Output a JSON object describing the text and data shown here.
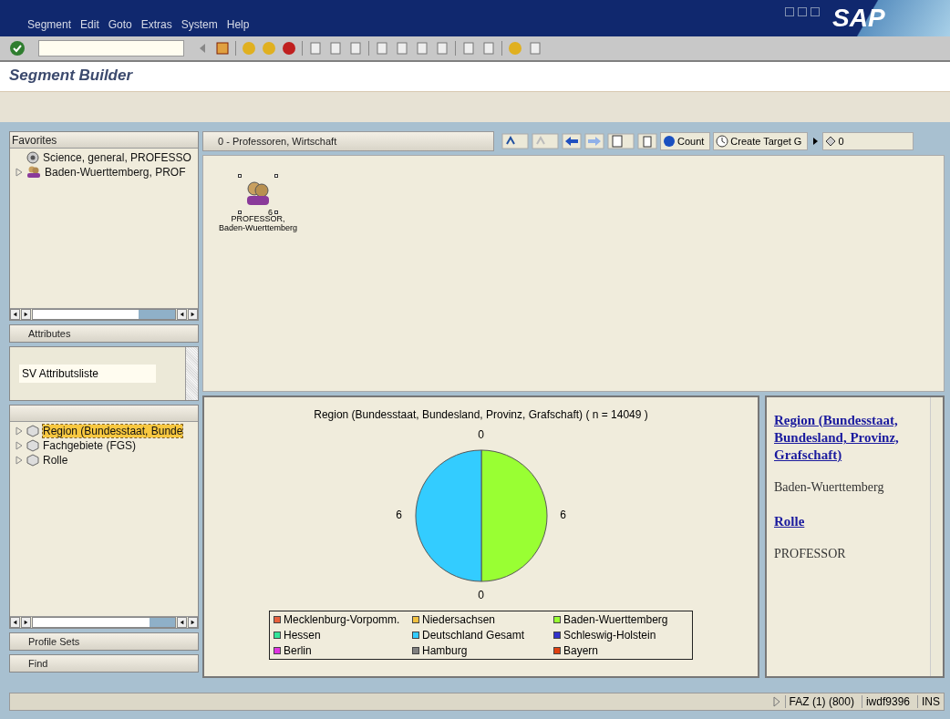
{
  "menu": [
    {
      "label": "Segment"
    },
    {
      "label": "Edit"
    },
    {
      "label": "Goto"
    },
    {
      "label": "Extras"
    },
    {
      "label": "System"
    },
    {
      "label": "Help"
    }
  ],
  "logo": "SAP",
  "page_title": "Segment Builder",
  "favorites": {
    "header": "Favorites",
    "items": [
      {
        "label": "Science, general, PROFESSO",
        "kind": "target",
        "expandable": false
      },
      {
        "label": "Baden-Wuerttemberg, PROF",
        "kind": "people",
        "expandable": true
      }
    ]
  },
  "attributes": {
    "button": "Attributes",
    "list": "SV Attributsliste",
    "tree": [
      {
        "label": "Region (Bundesstaat, Bunde",
        "selected": true
      },
      {
        "label": "Fachgebiete (FGS)",
        "selected": false
      },
      {
        "label": "Rolle",
        "selected": false
      }
    ]
  },
  "bottom_buttons": [
    "Profile Sets",
    "Find"
  ],
  "segment_bar": {
    "title": "0 - Professoren, Wirtschaft",
    "count_button": "Count",
    "target_button": "Create Target G",
    "counter": "0"
  },
  "node": {
    "count": "6",
    "label_1": "PROFESSOR,",
    "label_2": "Baden-Wuerttemberg"
  },
  "chart": {
    "chart_data": {
      "type": "pie",
      "title": "Region (Bundesstaat, Bundesland, Provinz, Grafschaft) ( n = 14049 )",
      "categories": [
        "Mecklenburg-Vorpomm.",
        "Niedersachsen",
        "Baden-Wuerttemberg",
        "Hessen",
        "Deutschland Gesamt",
        "Schleswig-Holstein",
        "Berlin",
        "Hamburg",
        "Bayern"
      ],
      "legend": true,
      "series": [
        {
          "colors": [
            "#e8603c",
            "#f0c040",
            "#99ff33",
            "#33e599",
            "#33ccff",
            "#3333cc",
            "#e033e0",
            "#808080",
            "#e04010"
          ],
          "values": [
            0,
            0,
            50,
            0,
            50,
            0,
            0,
            0,
            0
          ]
        }
      ],
      "value_labels": [
        "0",
        "6",
        "0",
        "6"
      ]
    }
  },
  "info": [
    {
      "kind": "link",
      "text": "Region (Bundesstaat, Bundesland, Provinz, Grafschaft)"
    },
    {
      "kind": "text",
      "text": "Baden-Wuerttemberg"
    },
    {
      "kind": "link",
      "text": "Rolle"
    },
    {
      "kind": "text",
      "text": "PROFESSOR"
    }
  ],
  "status": [
    "FAZ (1) (800)",
    "iwdf9396",
    "INS"
  ]
}
